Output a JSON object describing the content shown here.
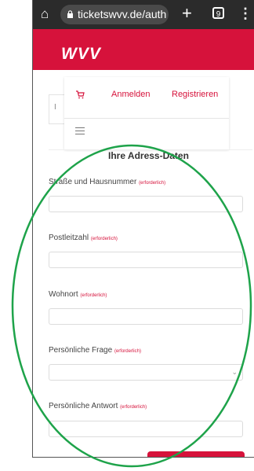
{
  "browser": {
    "url": "ticketswvv.de/auth",
    "tab_count": "9"
  },
  "brand": {
    "logo_text": "WVV",
    "color": "#d6123b"
  },
  "nav": {
    "anmelden": "Anmelden",
    "registrieren": "Registrieren",
    "left_mark": "I"
  },
  "form": {
    "section_title": "Ihre Adress-Daten",
    "required_tag": "(erforderlich)",
    "fields": [
      {
        "label": "Straße und Hausnummer",
        "value": ""
      },
      {
        "label": "Postleitzahl",
        "value": ""
      },
      {
        "label": "Wohnort",
        "value": ""
      },
      {
        "label": "Persönliche Frage",
        "value": ""
      },
      {
        "label": "Persönliche Antwort",
        "value": ""
      }
    ]
  },
  "annotation": {
    "color": "#1ea34a"
  }
}
